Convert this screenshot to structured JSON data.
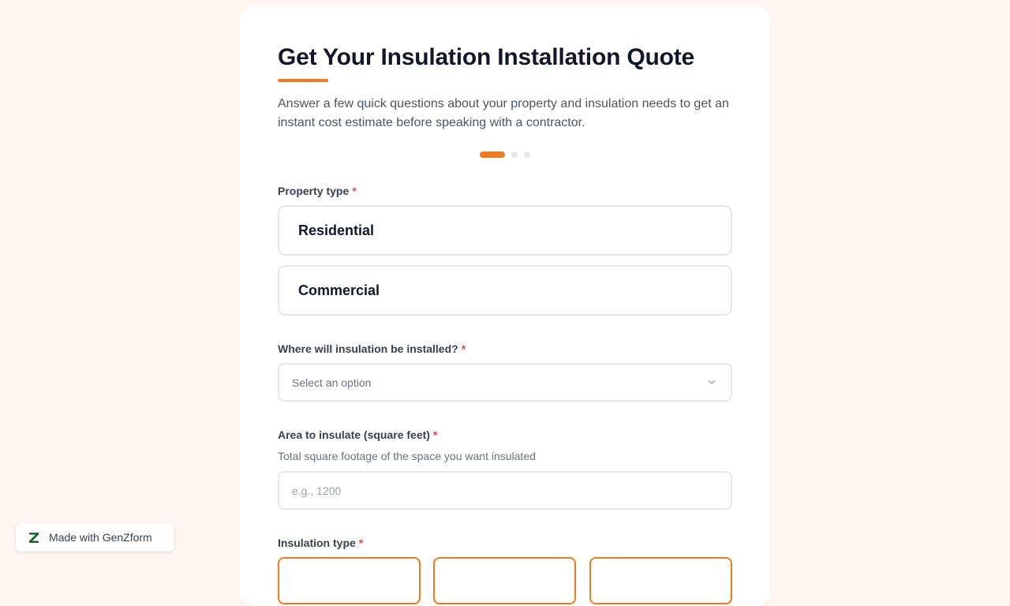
{
  "form": {
    "title": "Get Your Insulation Installation Quote",
    "subtitle": "Answer a few quick questions about your property and insulation needs to get an instant cost estimate before speaking with a contractor.",
    "progress": {
      "current_step": 1,
      "total_steps": 3
    },
    "accent_color": "#f07a1c",
    "required_marker": "*"
  },
  "fields": {
    "property_type": {
      "label": "Property type",
      "options": [
        "Residential",
        "Commercial"
      ]
    },
    "install_location": {
      "label": "Where will insulation be installed?",
      "placeholder": "Select an option",
      "icon": "chevron-down-icon"
    },
    "area": {
      "label": "Area to insulate (square feet)",
      "help": "Total square footage of the space you want insulated",
      "placeholder": "e.g., 1200"
    },
    "insulation_type": {
      "label": "Insulation type"
    }
  },
  "badge": {
    "text": "Made with GenZform",
    "logo_letter": "Z",
    "logo_color": "#166534"
  }
}
